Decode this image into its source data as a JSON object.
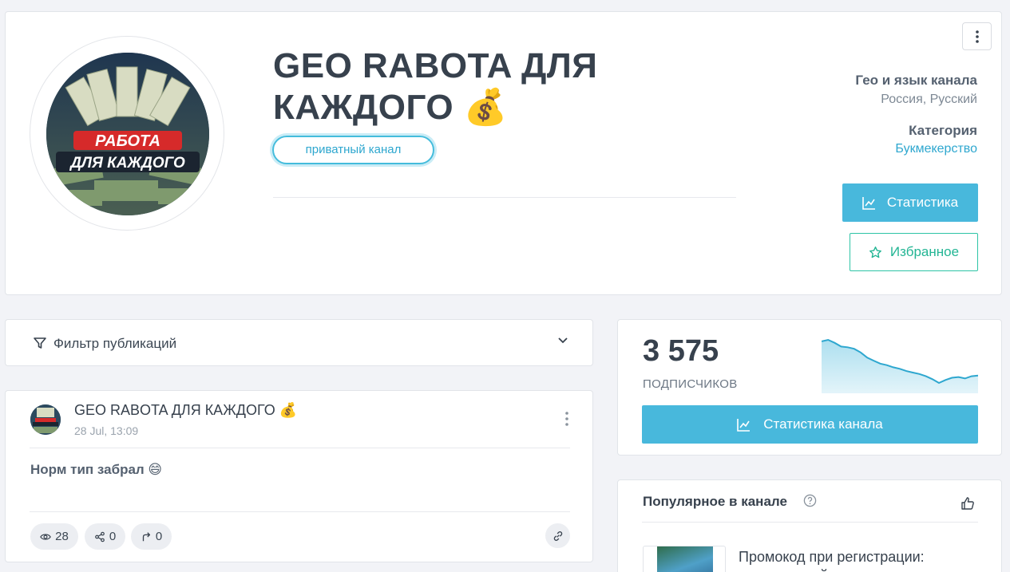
{
  "header": {
    "title": "GEO RABOTA ДЛЯ КАЖДОГО 💰",
    "badge": "приватный канал",
    "avatar_text_line1": "РАБОТА",
    "avatar_text_line2": "ДЛЯ КАЖДОГО",
    "geo_label": "Гео и язык канала",
    "geo_value": "Россия, Русский",
    "category_label": "Категория",
    "category_value": "Букмекерство",
    "stats_button": "Статистика",
    "favorite_button": "Избранное",
    "colors": {
      "accent": "#48b8dc",
      "favorite": "#2ec4a6"
    }
  },
  "filter": {
    "label": "Фильтр публикаций"
  },
  "post": {
    "author": "GEO RABOTA ДЛЯ КАЖДОГО 💰",
    "time": "28 Jul, 13:09",
    "text": "Норм тип забрал 😄",
    "views": "28",
    "shares": "0",
    "forwards": "0"
  },
  "subscribers": {
    "count": "3 575",
    "label": "ПОДПИСЧИКОВ",
    "button": "Статистика канала"
  },
  "chart_data": {
    "type": "area",
    "title": "",
    "xlabel": "",
    "ylabel": "",
    "values": [
      3620,
      3622,
      3618,
      3613,
      3612,
      3610,
      3605,
      3598,
      3594,
      3590,
      3588,
      3585,
      3583,
      3580,
      3578,
      3576,
      3573,
      3569,
      3564,
      3568,
      3571,
      3572,
      3570,
      3573,
      3574
    ],
    "grid": false
  },
  "popular": {
    "title": "Популярное в канале",
    "item_text": "Промокод при регистрации: СЛОВОНЛАЙН!"
  }
}
